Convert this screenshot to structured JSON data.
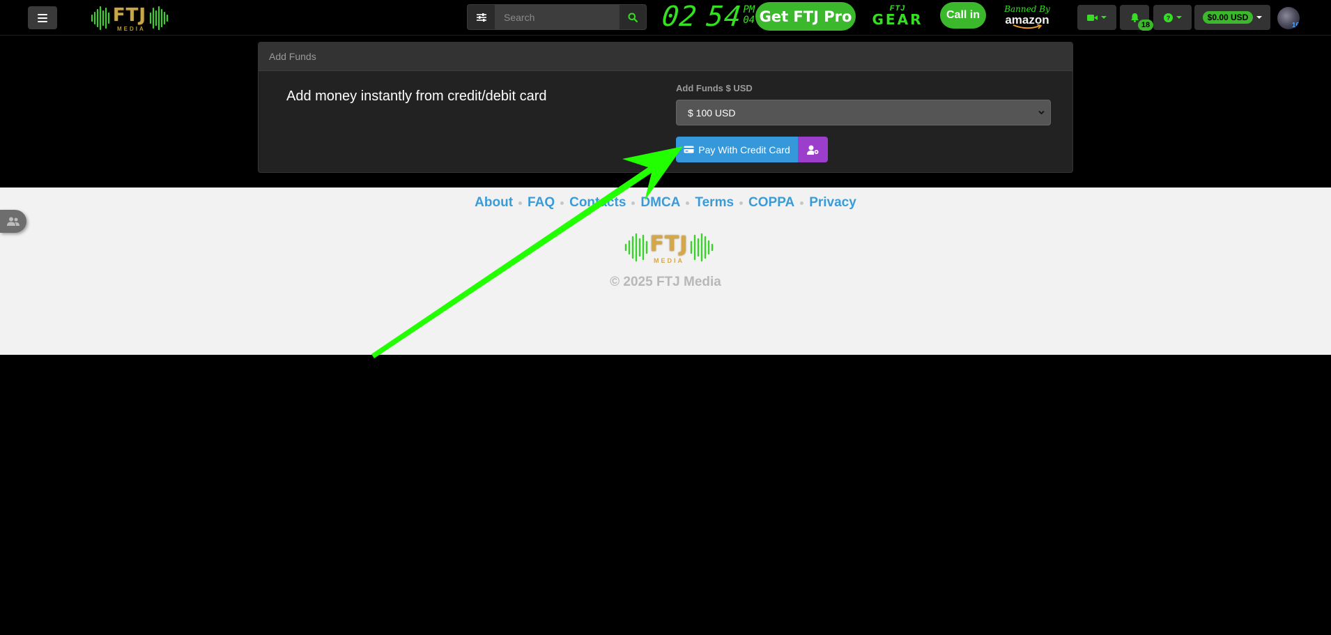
{
  "header": {
    "logo_text": "FTJ",
    "logo_subtext": "MEDIA",
    "search_placeholder": "Search",
    "clock": {
      "hours": "02",
      "minutes": "54",
      "ampm": "PM",
      "seconds": "04"
    },
    "get_pro_label": "Get FTJ Pro",
    "gear_logo": {
      "top": "FTJ",
      "bottom": "GEAR"
    },
    "call_in_label": "Call in",
    "amazon": {
      "line1": "Banned By",
      "line2": "amazon"
    },
    "notification_count": "18",
    "wallet_balance": "$0.00 USD",
    "avatar_level": "16",
    "icons": {
      "menu": "hamburger-icon",
      "filter": "sliders-icon",
      "search": "search-icon",
      "video": "video-camera-icon",
      "bell": "bell-icon",
      "help": "question-icon",
      "side_tab": "users-icon"
    }
  },
  "panel": {
    "title": "Add Funds",
    "lead_text": "Add money instantly from credit/debit card",
    "amount_label": "Add Funds $ USD",
    "amount_selected": "$ 100 USD",
    "pay_button_label": "Pay With Credit Card"
  },
  "footer": {
    "links": [
      "About",
      "FAQ",
      "Contacts",
      "DMCA",
      "Terms",
      "COPPA",
      "Privacy"
    ],
    "logo_text": "FTJ",
    "logo_subtext": "MEDIA",
    "copyright": "© 2025 FTJ Media"
  },
  "colors": {
    "accent_green": "#34e021",
    "button_green": "#3bb82b",
    "pay_blue": "#3498db",
    "purple": "#9b3ecc",
    "arrow_green": "#22ff00"
  }
}
